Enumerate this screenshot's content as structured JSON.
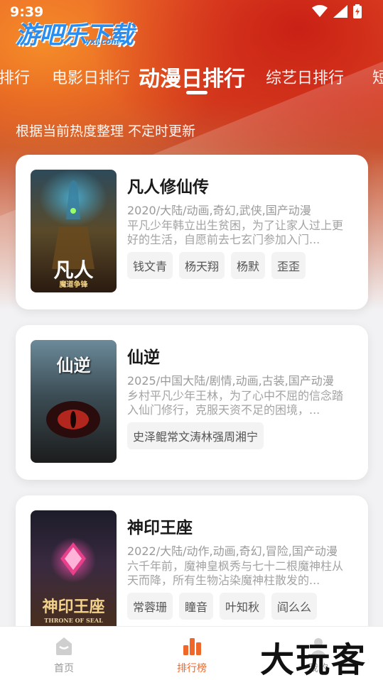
{
  "status_bar": {
    "time": "9:39"
  },
  "logo": {
    "main": "游吧乐下载",
    "sub": "yxl.com"
  },
  "tabs": [
    {
      "label": "排行"
    },
    {
      "label": "电影日排行"
    },
    {
      "label": "动漫日排行"
    },
    {
      "label": "综艺日排行"
    },
    {
      "label": "短"
    }
  ],
  "subtitle": "根据当前热度整理 不定时更新",
  "cards": [
    {
      "title": "凡人修仙传",
      "meta": "2020/大陆/动画,奇幻,武侠,国产动漫",
      "desc": "平凡少年韩立出生贫困，为了让家人过上更好的生活，自愿前去七玄门参加入门...",
      "tags": [
        "钱文青",
        "杨天翔",
        "杨默",
        "歪歪"
      ],
      "poster_title": "凡人",
      "poster_sub": "魔道争锋"
    },
    {
      "title": "仙逆",
      "meta": "2025/中国大陆/剧情,动画,古装,国产动漫",
      "desc": "乡村平凡少年王林，为了心中不屈的信念踏入仙门修行，克服天资不足的困境，...",
      "tags": [
        "史泽鲲常文涛林强周湘宁"
      ],
      "poster_title": "仙逆",
      "poster_sub": ""
    },
    {
      "title": "神印王座",
      "meta": "2022/大陆/动作,动画,奇幻,冒险,国产动漫",
      "desc": "六千年前，魔神皇枫秀与七十二根魔神柱从天而降，所有生物沾染魔神柱散发的...",
      "tags": [
        "常蓉珊",
        "瞳音",
        "叶知秋",
        "阎么么"
      ],
      "poster_title": "神印王座",
      "poster_sub": "THRONE OF SEAL"
    }
  ],
  "bottom_nav": [
    {
      "label": "首页",
      "icon": "home-icon"
    },
    {
      "label": "排行榜",
      "icon": "ranking-icon"
    },
    {
      "label": "我的",
      "icon": "profile-icon"
    }
  ],
  "watermark": "大玩客",
  "colors": {
    "accent": "#f0672a",
    "hero": "#d9421f",
    "logo": "#2a8df0"
  }
}
